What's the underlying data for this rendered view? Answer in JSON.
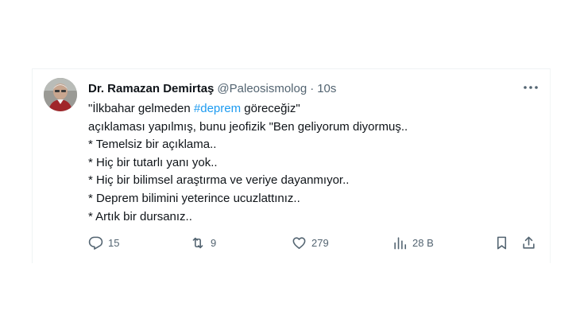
{
  "tweet": {
    "author": {
      "display_name": "Dr. Ramazan Demirtaş",
      "handle": "@Paleosismolog",
      "separator": "·",
      "time": "10s"
    },
    "body": {
      "line1_prefix": "\"İlkbahar gelmeden ",
      "line1_hashtag": "#deprem",
      "line1_suffix": " göreceğiz\"",
      "line2": "açıklaması yapılmış, bunu jeofizik \"Ben geliyorum diyormuş..",
      "line3": "* Temelsiz bir açıklama..",
      "line4": "* Hiç bir tutarlı yanı yok..",
      "line5": "* Hiç bir bilimsel araştırma ve veriye dayanmıyor..",
      "line6": "* Deprem bilimini yeterince ucuzlattınız..",
      "line7": "* Artık bir dursanız.."
    },
    "actions": {
      "replies": "15",
      "reposts": "9",
      "likes": "279",
      "views": "28 B"
    },
    "icons": {
      "more": "more-horizontal-icon",
      "reply": "reply-icon",
      "repost": "repost-icon",
      "like": "heart-icon",
      "views": "views-chart-icon",
      "bookmark": "bookmark-icon",
      "share": "share-icon"
    },
    "colors": {
      "text": "#0f1419",
      "secondary": "#536471",
      "link": "#1d9bf0",
      "border": "#eff3f4"
    }
  }
}
